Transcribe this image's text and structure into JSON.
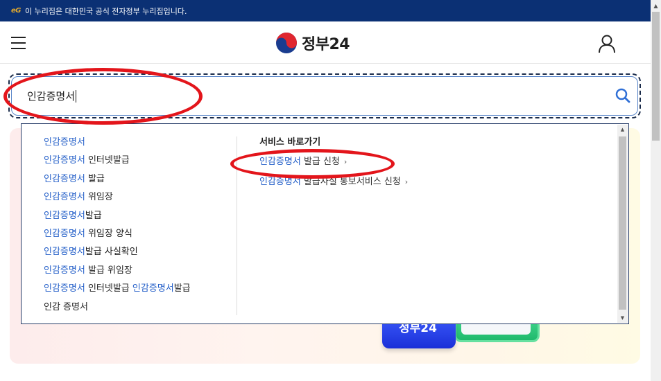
{
  "gov_banner": {
    "logo_text": "eG",
    "text": "이 누리집은 대한민국 공식 전자정부 누리집입니다."
  },
  "header": {
    "logo_text": "정부24",
    "menu_icon": "hamburger-menu-icon",
    "user_icon": "user-icon"
  },
  "search": {
    "value": "인감증명서",
    "icon": "search-icon",
    "colors": {
      "border": "#5a86c9",
      "icon": "#2f6fd6"
    }
  },
  "suggestions": [
    {
      "hl": "인감증명서",
      "rest": ""
    },
    {
      "hl": "인감증명서",
      "rest": " 인터넷발급"
    },
    {
      "hl": "인감증명서",
      "rest": " 발급"
    },
    {
      "hl": "인감증명서",
      "rest": " 위임장"
    },
    {
      "hl": "인감증명서",
      "rest": "발급"
    },
    {
      "hl": "인감증명서",
      "rest": " 위임장 양식"
    },
    {
      "hl": "인감증명서",
      "rest": "발급 사실확인"
    },
    {
      "hl": "인감증명서",
      "rest": " 발급 위임장"
    },
    {
      "hl": "인감증명서",
      "rest": " 인터넷발급 ",
      "hl2": "인감증명서",
      "rest2": "발급"
    },
    {
      "hl": "",
      "rest": "인감 증명서"
    }
  ],
  "services": {
    "title": "서비스 바로가기",
    "items": [
      {
        "hl": "인감증명서",
        "rest": " 발급 신청"
      },
      {
        "hl": "인감증명서",
        "rest": " 발급사실 통보서비스 신청"
      }
    ]
  },
  "promo": {
    "badge_text": "정부24"
  },
  "colors": {
    "gov_bar": "#0b3074",
    "highlight": "#2560c9",
    "annotation": "#e3151b"
  }
}
